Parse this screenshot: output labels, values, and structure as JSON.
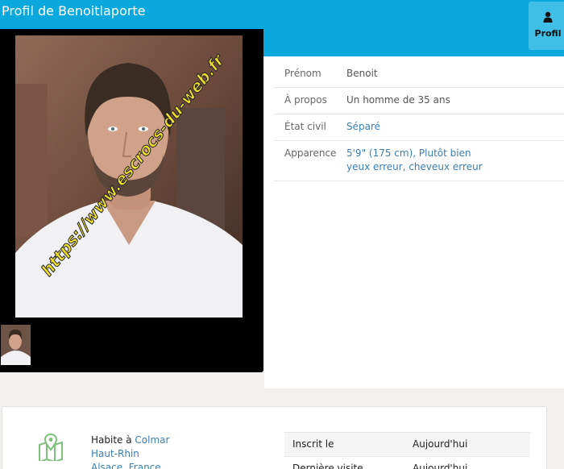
{
  "header": {
    "title": "Profil de Benoitlaporte"
  },
  "tab": {
    "label": "Profil",
    "icon": "user-icon"
  },
  "profile_info": [
    {
      "key": "Prénom",
      "value": "Benoit"
    },
    {
      "key": "À propos",
      "value": "Un homme de 35 ans"
    },
    {
      "key": "État civil",
      "value": "Séparé"
    },
    {
      "key": "Apparence",
      "value": "5'9\" (175 cm), Plutôt bien",
      "value2": "yeux erreur, cheveux erreur"
    }
  ],
  "photo": {
    "watermark": "https://www.escrocs-du-web.fr"
  },
  "location": {
    "prefix": "Habite à",
    "city": "Colmar",
    "region": "Haut-Rhin",
    "country_line": "Alsace, France",
    "icon": "map-pin-icon"
  },
  "stats": [
    {
      "key": "Inscrit le",
      "value": "Aujourd'hui"
    },
    {
      "key": "Dernière visite",
      "value": "Aujourd'hui"
    }
  ],
  "colors": {
    "header": "#0aa8dc",
    "tab": "#3fbfe8",
    "link": "#3a7fb3"
  }
}
